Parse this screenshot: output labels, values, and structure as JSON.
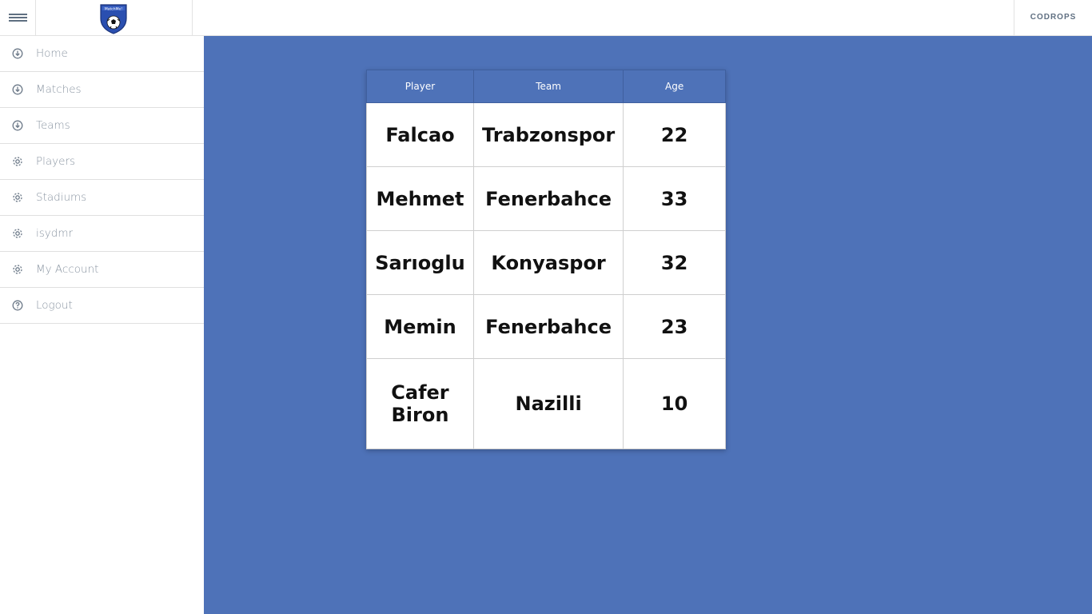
{
  "header": {
    "logo_text": "MatchMe!",
    "right_link": "CODROPS"
  },
  "sidebar": {
    "items": [
      {
        "label": "Home",
        "icon": "download-circle-icon"
      },
      {
        "label": "Matches",
        "icon": "download-circle-icon"
      },
      {
        "label": "Teams",
        "icon": "download-circle-icon"
      },
      {
        "label": "Players",
        "icon": "gear-icon"
      },
      {
        "label": "Stadiums",
        "icon": "gear-icon"
      },
      {
        "label": "isydmr",
        "icon": "gear-icon"
      },
      {
        "label": "My Account",
        "icon": "gear-icon"
      },
      {
        "label": "Logout",
        "icon": "help-circle-icon"
      }
    ]
  },
  "table": {
    "headers": [
      "Player",
      "Team",
      "Age"
    ],
    "rows": [
      {
        "player": "Falcao",
        "team": "Trabzonspor",
        "age": "22"
      },
      {
        "player": "Mehmet",
        "team": "Fenerbahce",
        "age": "33"
      },
      {
        "player": "Sarıoglu",
        "team": "Konyaspor",
        "age": "32"
      },
      {
        "player": "Memin",
        "team": "Fenerbahce",
        "age": "23"
      },
      {
        "player": "Cafer Biron",
        "team": "Nazilli",
        "age": "10"
      }
    ]
  },
  "colors": {
    "background": "#4e72b8",
    "header_bg": "#4e72b8",
    "sidebar_text": "#8a95a2"
  }
}
